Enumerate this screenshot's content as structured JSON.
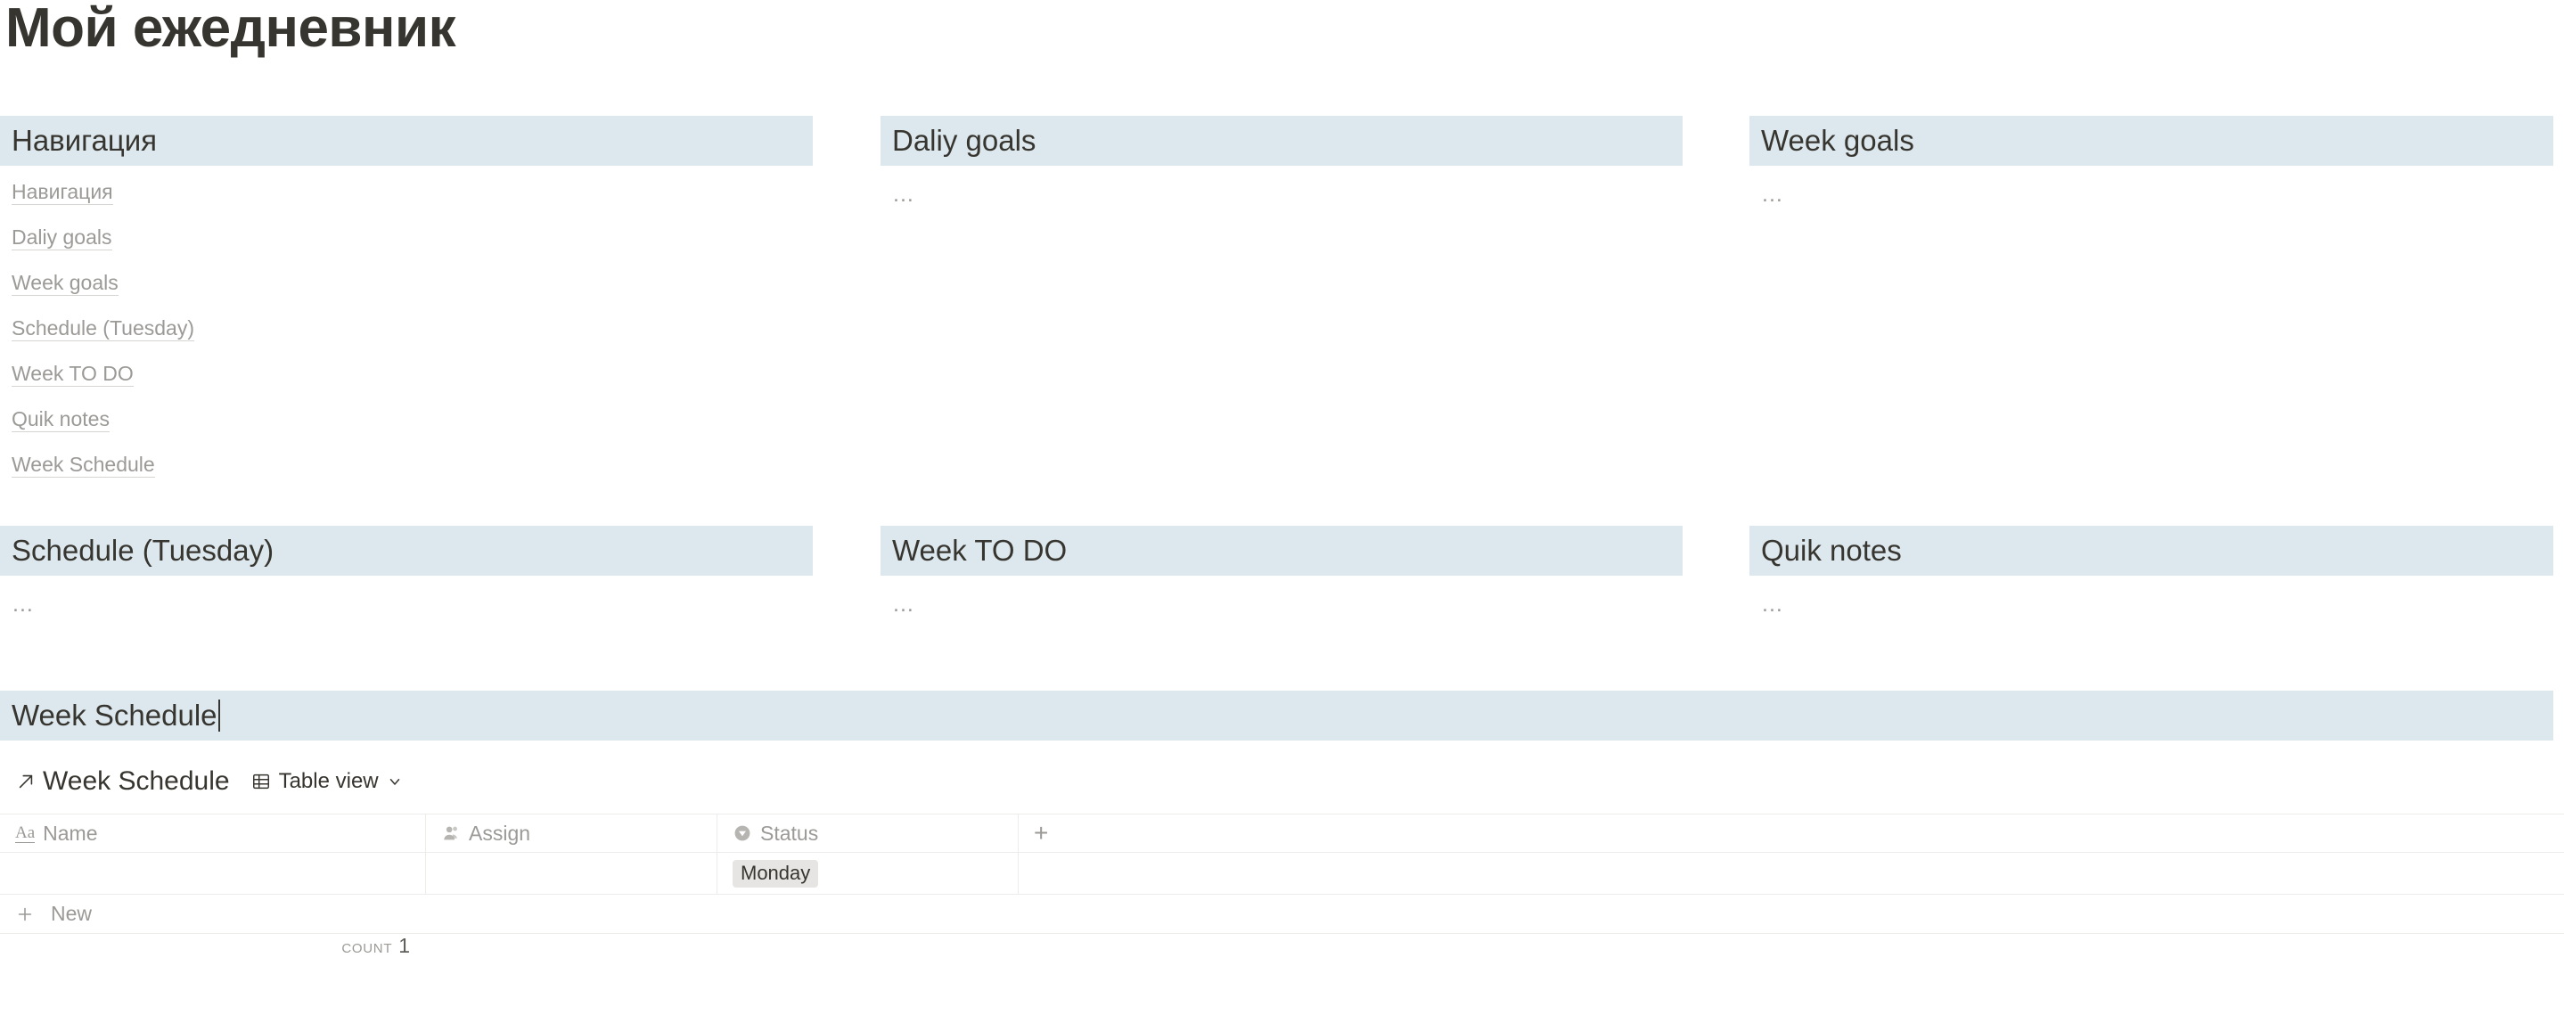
{
  "page": {
    "title": "Мой ежедневник"
  },
  "sections": {
    "navigation": {
      "heading": "Навигация",
      "links": [
        {
          "label": "Навигация"
        },
        {
          "label": "Daliy goals"
        },
        {
          "label": "Week goals"
        },
        {
          "label": "Schedule (Tuesday)"
        },
        {
          "label": "Week TO DO"
        },
        {
          "label": "Quik notes"
        },
        {
          "label": "Week Schedule"
        }
      ]
    },
    "daily_goals": {
      "heading": "Daliy goals",
      "placeholder": "..."
    },
    "week_goals": {
      "heading": "Week goals",
      "placeholder": "..."
    },
    "schedule_tuesday": {
      "heading": "Schedule (Tuesday)",
      "placeholder": "..."
    },
    "week_todo": {
      "heading": "Week TO DO",
      "placeholder": "..."
    },
    "quik_notes": {
      "heading": "Quik notes",
      "placeholder": "..."
    },
    "week_schedule": {
      "heading": "Week Schedule"
    }
  },
  "database": {
    "title": "Week Schedule",
    "view_label": "Table view",
    "open_icon": "arrow-up-right-icon",
    "view_icon": "table-icon",
    "chevron_icon": "chevron-down-icon",
    "columns": [
      {
        "label": "Name",
        "icon": "text-aa-icon"
      },
      {
        "label": "Assign",
        "icon": "person-icon"
      },
      {
        "label": "Status",
        "icon": "select-circle-icon"
      },
      {
        "label": "+",
        "icon": "plus-icon"
      }
    ],
    "rows": [
      {
        "name": "",
        "assign": "",
        "status": "Monday"
      }
    ],
    "new_row_label": "New",
    "footer": {
      "count_label": "COUNT",
      "count_value": "1"
    }
  },
  "colors": {
    "heading_band": "#dde8ee",
    "text": "#37352f",
    "muted": "#9b9a97",
    "tag_bg": "#e6e5e3",
    "border": "#ececeb"
  }
}
